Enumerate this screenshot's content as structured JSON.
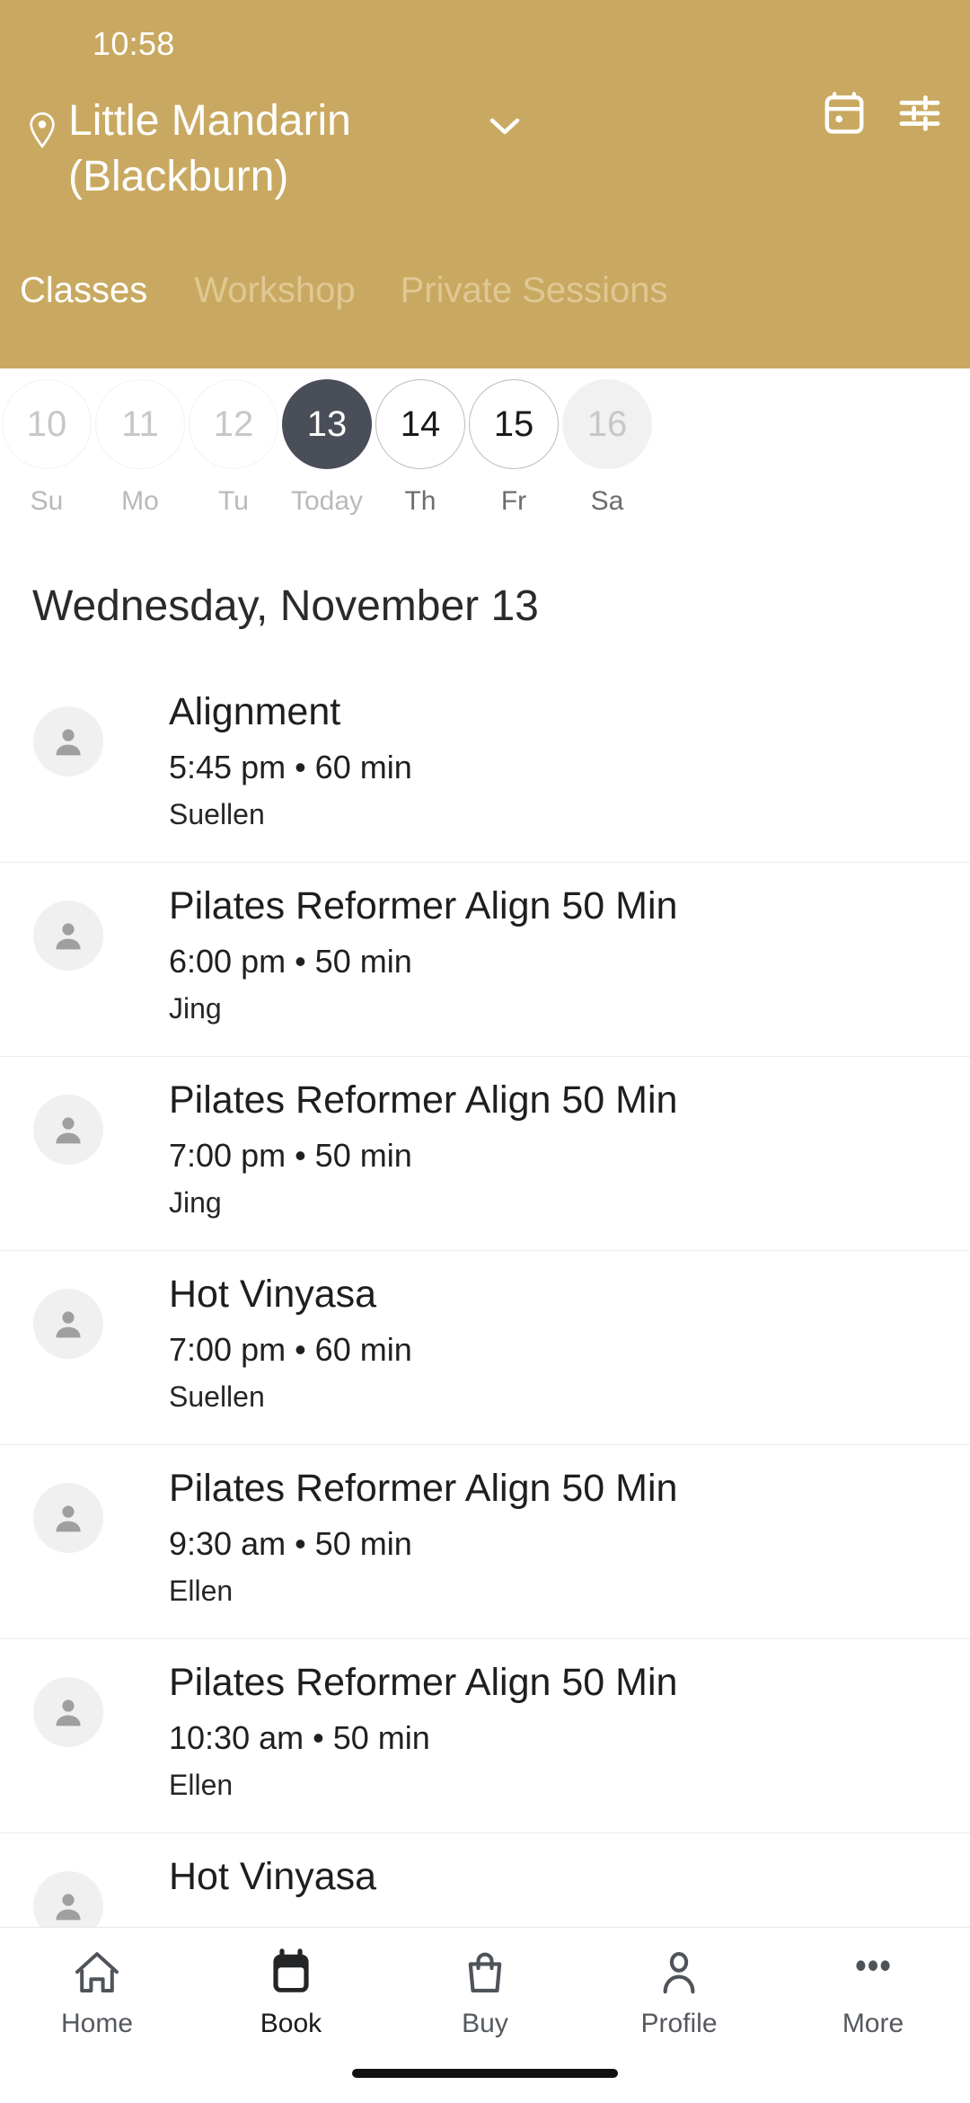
{
  "status_bar": {
    "time": "10:58"
  },
  "header": {
    "background_color": "#C9A961",
    "location_name": "Little Mandarin (Blackburn)",
    "location_pin_icon": "location-pin-icon",
    "chevron_icon": "chevron-down-icon",
    "calendar_icon": "calendar-icon",
    "filter_icon": "filter-sliders-icon",
    "tabs": [
      {
        "label": "Classes",
        "active": true
      },
      {
        "label": "Workshop",
        "active": false
      },
      {
        "label": "Private Sessions",
        "active": false
      }
    ]
  },
  "date_strip": {
    "days": [
      {
        "date": "10",
        "label": "Su",
        "state": "past"
      },
      {
        "date": "11",
        "label": "Mo",
        "state": "past"
      },
      {
        "date": "12",
        "label": "Tu",
        "state": "past"
      },
      {
        "date": "13",
        "label": "Today",
        "state": "selected"
      },
      {
        "date": "14",
        "label": "Th",
        "state": "available"
      },
      {
        "date": "15",
        "label": "Fr",
        "state": "available"
      },
      {
        "date": "16",
        "label": "Sa",
        "state": "muted"
      }
    ],
    "selected_color": "#4A4E58"
  },
  "schedule": {
    "day_heading": "Wednesday, November 13",
    "classes": [
      {
        "title": "Alignment",
        "meta": "5:45 pm • 60 min",
        "instructor": "Suellen",
        "avatar_icon": "person-avatar-icon"
      },
      {
        "title": "Pilates Reformer Align 50 Min",
        "meta": "6:00 pm • 50 min",
        "instructor": "Jing",
        "avatar_icon": "person-avatar-icon"
      },
      {
        "title": "Pilates Reformer Align 50 Min",
        "meta": "7:00 pm • 50 min",
        "instructor": "Jing",
        "avatar_icon": "person-avatar-icon"
      },
      {
        "title": "Hot Vinyasa",
        "meta": "7:00 pm • 60 min",
        "instructor": "Suellen",
        "avatar_icon": "person-avatar-icon"
      },
      {
        "title": "Pilates Reformer Align 50 Min",
        "meta": "9:30 am • 50 min",
        "instructor": "Ellen",
        "avatar_icon": "person-avatar-icon"
      },
      {
        "title": "Pilates Reformer Align 50 Min",
        "meta": "10:30 am • 50 min",
        "instructor": "Ellen",
        "avatar_icon": "person-avatar-icon"
      },
      {
        "title": "Hot Vinyasa",
        "meta": "",
        "instructor": "",
        "avatar_icon": "person-avatar-icon"
      }
    ]
  },
  "bottom_nav": {
    "items": [
      {
        "label": "Home",
        "icon": "home-icon",
        "active": false
      },
      {
        "label": "Book",
        "icon": "calendar-icon",
        "active": true
      },
      {
        "label": "Buy",
        "icon": "shopping-bag-icon",
        "active": false
      },
      {
        "label": "Profile",
        "icon": "person-icon",
        "active": false
      },
      {
        "label": "More",
        "icon": "more-dots-icon",
        "active": false
      }
    ]
  }
}
